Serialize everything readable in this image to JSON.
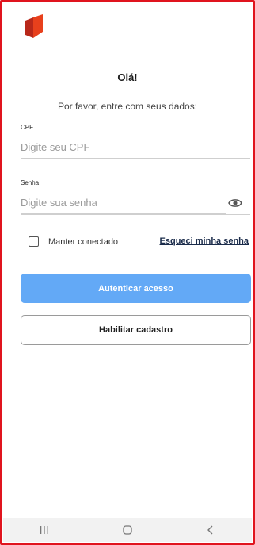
{
  "login": {
    "greeting": "Olá!",
    "subtitle": "Por favor, entre com seus dados:",
    "cpf": {
      "label": "CPF",
      "placeholder": "Digite seu CPF",
      "value": ""
    },
    "password": {
      "label": "Senha",
      "placeholder": "Digite sua senha",
      "value": ""
    },
    "remember_label": "Manter conectado",
    "remember_checked": false,
    "forgot_label": "Esqueci minha senha",
    "primary_button": "Autenticar acesso",
    "secondary_button": "Habilitar cadastro"
  },
  "icons": {
    "logo": "brand-logo",
    "password_toggle": "eye-icon",
    "nav_recents": "recents-icon",
    "nav_home": "home-icon",
    "nav_back": "back-icon"
  },
  "colors": {
    "frame_border": "#e0141e",
    "logo_primary": "#e8401c",
    "logo_secondary": "#b8281a",
    "primary_button": "#63a9f6",
    "link": "#1a2b4a",
    "navbar": "#f2f2f2"
  }
}
